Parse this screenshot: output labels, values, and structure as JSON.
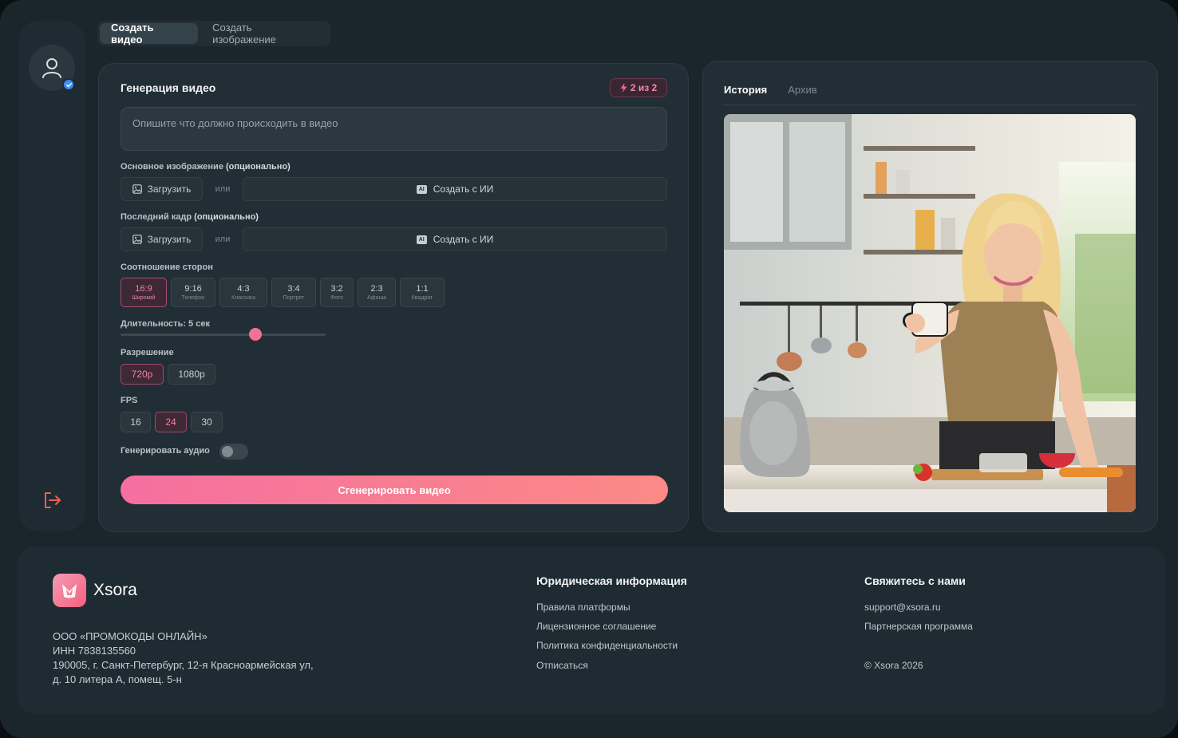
{
  "tabs": {
    "create_video": "Создать видео",
    "create_image": "Создать изображение"
  },
  "generation": {
    "title": "Генерация видео",
    "credits": "2 из 2",
    "prompt_placeholder": "Опишите что должно происходить в видео",
    "main_image_label": "Основное изображение",
    "last_frame_label": "Последний кадр",
    "optional": "(опционально)",
    "upload": "Загрузить",
    "or": "или",
    "ai_chip": "AI",
    "create_ai": "Создать с ИИ",
    "aspect_label": "Соотношение сторон",
    "aspect_ratios": [
      {
        "ratio": "16:9",
        "name": "Широкий"
      },
      {
        "ratio": "9:16",
        "name": "Телефон"
      },
      {
        "ratio": "4:3",
        "name": "Классика"
      },
      {
        "ratio": "3:4",
        "name": "Портрет"
      },
      {
        "ratio": "3:2",
        "name": "Фото"
      },
      {
        "ratio": "2:3",
        "name": "Афиша"
      },
      {
        "ratio": "1:1",
        "name": "Квадрат"
      }
    ],
    "selected_aspect": "16:9",
    "duration_label": "Длительность: 5 сек",
    "duration_value": 5,
    "resolution_label": "Разрешение",
    "resolutions": [
      "720p",
      "1080p"
    ],
    "selected_resolution": "720p",
    "fps_label": "FPS",
    "fps_options": [
      "16",
      "24",
      "30"
    ],
    "selected_fps": "24",
    "audio_label": "Генерировать аудио",
    "audio_enabled": false,
    "generate_button": "Сгенерировать видео"
  },
  "history": {
    "tab_history": "История",
    "tab_archive": "Архив"
  },
  "footer": {
    "brand": "Xsora",
    "company_lines": [
      "ООО «ПРОМОКОДЫ ОНЛАЙН»",
      "ИНН 7838135560",
      "190005, г. Санкт-Петербург, 12-я Красноармейская ул,",
      "д. 10 литера А, помещ. 5-н"
    ],
    "legal_title": "Юридическая информация",
    "legal_links": [
      "Правила платформы",
      "Лицензионное соглашение",
      "Политика конфиденциальности",
      "Отписаться"
    ],
    "contact_title": "Свяжитесь с нами",
    "contact_links": [
      "support@xsora.ru",
      "Партнерская программа"
    ],
    "copyright": "© Xsora 2026"
  },
  "colors": {
    "accent": "#f56f96",
    "background": "#1b252c",
    "panel": "#222e35"
  }
}
